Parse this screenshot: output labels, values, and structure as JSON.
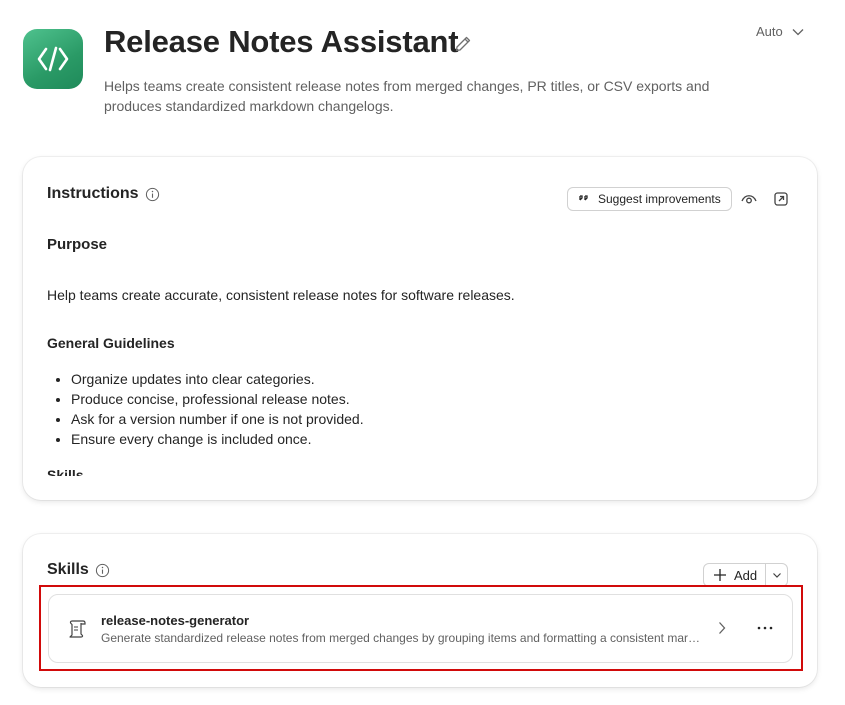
{
  "header": {
    "title": "Release Notes Assistant",
    "description": "Helps teams create consistent release notes from merged changes, PR titles, or CSV exports and produces standardized markdown changelogs.",
    "model_select": "Auto"
  },
  "instructions": {
    "heading": "Instructions",
    "suggest_label": "Suggest improvements",
    "purpose_heading": "Purpose",
    "purpose_text": "Help teams create accurate, consistent release notes for software releases.",
    "guidelines_heading": "General Guidelines",
    "guidelines": [
      "Organize updates into clear categories.",
      "Produce concise, professional release notes.",
      "Ask for a version number if one is not provided.",
      "Ensure every change is included once."
    ],
    "skills_heading_partial": "Skills"
  },
  "skills": {
    "heading": "Skills",
    "add_label": "Add",
    "items": [
      {
        "name": "release-notes-generator",
        "description": "Generate standardized release notes from merged changes by grouping items and formatting a consistent markdown changelog."
      }
    ]
  },
  "colors": {
    "app_icon": "#2a9a66",
    "highlight": "#d10a0a",
    "text_primary": "#242424",
    "text_secondary": "#616161"
  },
  "icons": [
    "code-brackets-icon",
    "pencil-icon",
    "chevron-down-icon",
    "info-icon",
    "quote-icon",
    "eye-icon",
    "open-external-icon",
    "plus-icon",
    "scroll-icon",
    "chevron-right-icon",
    "more-icon"
  ]
}
